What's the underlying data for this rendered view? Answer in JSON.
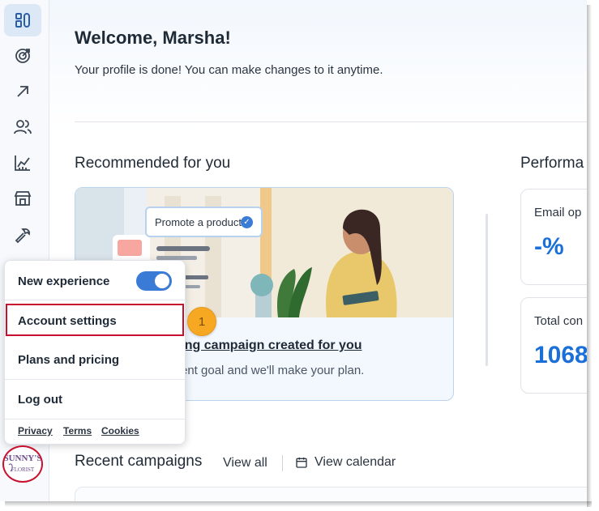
{
  "sidebar": {
    "items": [
      {
        "icon": "dashboard-icon",
        "active": true
      },
      {
        "icon": "target-icon",
        "active": false
      },
      {
        "icon": "arrow-up-right-icon",
        "active": false
      },
      {
        "icon": "audience-icon",
        "active": false
      },
      {
        "icon": "analytics-icon",
        "active": false
      },
      {
        "icon": "store-icon",
        "active": false
      },
      {
        "icon": "wrench-icon",
        "active": false
      }
    ],
    "avatar": {
      "icon": "sunnys-florist-logo",
      "text": "SUNNY'S FLORIST"
    }
  },
  "header": {
    "greeting": "Welcome, Marsha!",
    "subtext": "Your profile is done! You can make changes to it anytime."
  },
  "recommended": {
    "title": "Recommended for you",
    "chip_label": "Promote a product",
    "link_visible": "ting campaign created for you",
    "desc_visible": "rent goal and we'll make your plan."
  },
  "performance": {
    "title": "Performa",
    "cards": [
      {
        "label": "Email op",
        "value": "-%"
      },
      {
        "label": "Total con",
        "value": "1068"
      }
    ]
  },
  "recent": {
    "title": "Recent campaigns",
    "view_all": "View all",
    "view_calendar": "View calendar"
  },
  "menu": {
    "new_experience": "New experience",
    "toggle_on": true,
    "account_settings": "Account settings",
    "plans_pricing": "Plans and pricing",
    "log_out": "Log out",
    "footer": {
      "privacy": "Privacy",
      "terms": "Terms",
      "cookies": "Cookies"
    }
  },
  "callout": {
    "number": "1"
  },
  "colors": {
    "accent": "#3a7bd5",
    "highlight": "#c8102e",
    "callout": "#f7a823",
    "value": "#1a6fd8"
  }
}
